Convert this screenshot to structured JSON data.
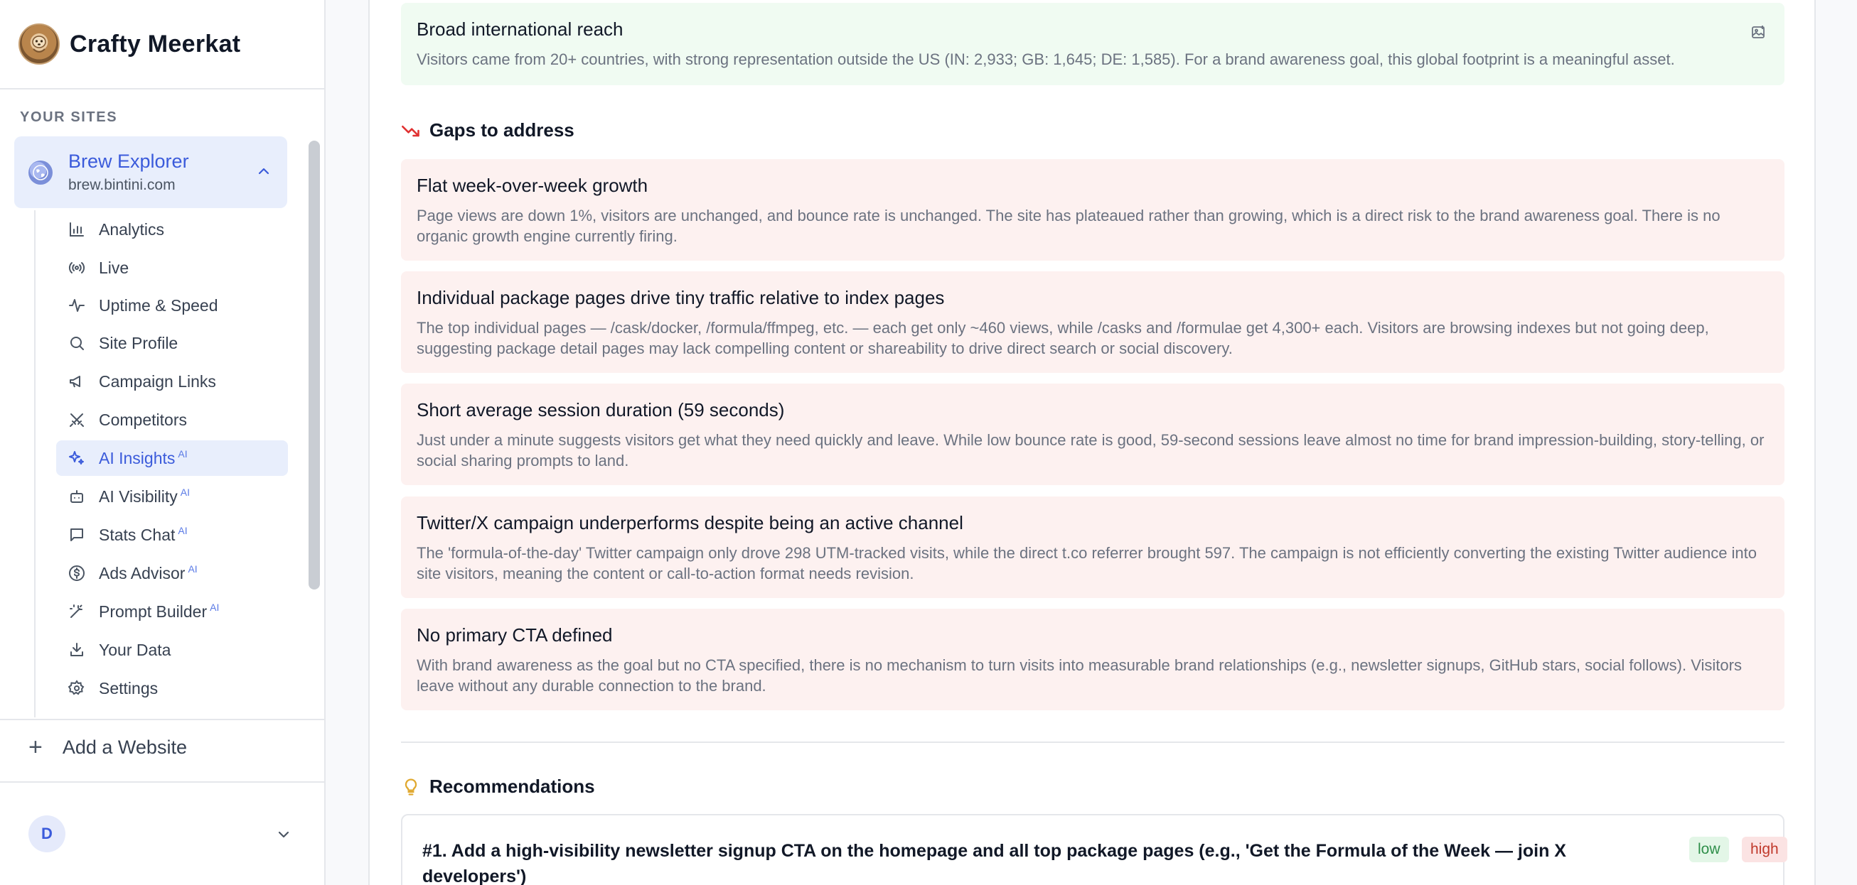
{
  "brand": {
    "name": "Crafty Meerkat"
  },
  "sidebar": {
    "section_label": "YOUR SITES",
    "site": {
      "name": "Brew Explorer",
      "domain": "brew.bintini.com"
    },
    "items": [
      {
        "label": "Analytics",
        "icon": "bar-chart-icon",
        "ai": ""
      },
      {
        "label": "Live",
        "icon": "broadcast-icon",
        "ai": ""
      },
      {
        "label": "Uptime & Speed",
        "icon": "pulse-icon",
        "ai": ""
      },
      {
        "label": "Site Profile",
        "icon": "search-icon",
        "ai": ""
      },
      {
        "label": "Campaign Links",
        "icon": "megaphone-icon",
        "ai": ""
      },
      {
        "label": "Competitors",
        "icon": "swords-icon",
        "ai": ""
      },
      {
        "label": "AI Insights",
        "icon": "sparkles-icon",
        "ai": "AI"
      },
      {
        "label": "AI Visibility",
        "icon": "robot-icon",
        "ai": "AI"
      },
      {
        "label": "Stats Chat",
        "icon": "chat-icon",
        "ai": "AI"
      },
      {
        "label": "Ads Advisor",
        "icon": "dollar-icon",
        "ai": "AI"
      },
      {
        "label": "Prompt Builder",
        "icon": "wand-icon",
        "ai": "AI"
      },
      {
        "label": "Your Data",
        "icon": "download-icon",
        "ai": ""
      },
      {
        "label": "Settings",
        "icon": "gear-icon",
        "ai": ""
      }
    ],
    "add_site": "Add a Website",
    "user_initial": "D"
  },
  "main": {
    "strength_card": {
      "title": "Broad international reach",
      "body": "Visitors came from 20+ countries, with strong representation outside the US (IN: 2,933; GB: 1,645; DE: 1,585). For a brand awareness goal, this global footprint is a meaningful asset."
    },
    "gaps_heading": "Gaps to address",
    "gaps": [
      {
        "title": "Flat week-over-week growth",
        "body": "Page views are down 1%, visitors are unchanged, and bounce rate is unchanged. The site has plateaued rather than growing, which is a direct risk to the brand awareness goal. There is no organic growth engine currently firing."
      },
      {
        "title": "Individual package pages drive tiny traffic relative to index pages",
        "body": "The top individual pages — /cask/docker, /formula/ffmpeg, etc. — each get only ~460 views, while /casks and /formulae get 4,300+ each. Visitors are browsing indexes but not going deep, suggesting package detail pages may lack compelling content or shareability to drive direct search or social discovery."
      },
      {
        "title": "Short average session duration (59 seconds)",
        "body": "Just under a minute suggests visitors get what they need quickly and leave. While low bounce rate is good, 59-second sessions leave almost no time for brand impression-building, story-telling, or social sharing prompts to land."
      },
      {
        "title": "Twitter/X campaign underperforms despite being an active channel",
        "body": "The 'formula-of-the-day' Twitter campaign only drove 298 UTM-tracked visits, while the direct t.co referrer brought 597. The campaign is not efficiently converting the existing Twitter audience into site visitors, meaning the content or call-to-action format needs revision."
      },
      {
        "title": "No primary CTA defined",
        "body": "With brand awareness as the goal but no CTA specified, there is no mechanism to turn visits into measurable brand relationships (e.g., newsletter signups, GitHub stars, social follows). Visitors leave without any durable connection to the brand."
      }
    ],
    "recommendations_heading": "Recommendations",
    "recommendation": {
      "title": "#1. Add a high-visibility newsletter signup CTA on the homepage and all top package pages (e.g., 'Get the Formula of the Week — join X developers')",
      "effort": "low",
      "impact": "high"
    }
  },
  "colors": {
    "accent": "#3b5bdb",
    "strength_bg": "#f0fbf2",
    "gap_bg": "#fdf1f0",
    "gap_icon": "#e03131",
    "bulb": "#e0a82e"
  }
}
